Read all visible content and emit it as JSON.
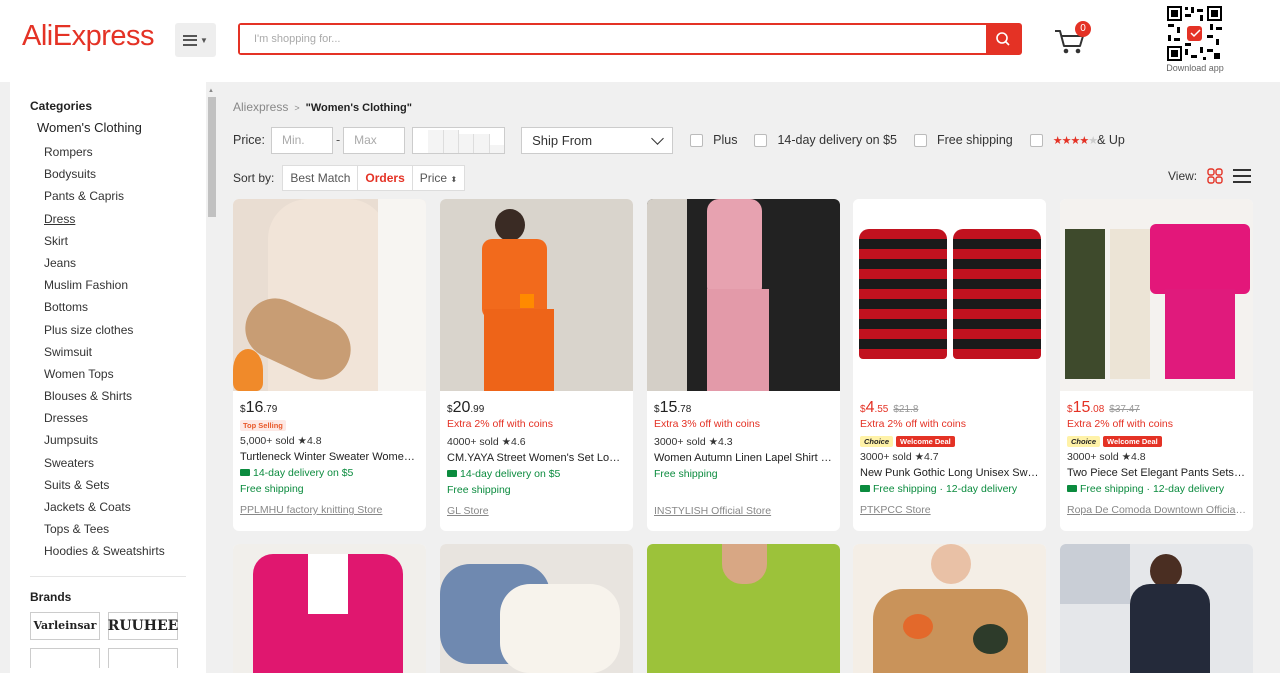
{
  "header": {
    "logo": "AliExpress",
    "search_placeholder": "I'm shopping for...",
    "cart_count": "0",
    "download_label": "Download app",
    "colors": {
      "accent": "#e43225"
    }
  },
  "sidebar": {
    "categories_title": "Categories",
    "main_category": "Women's Clothing",
    "items": [
      "Rompers",
      "Bodysuits",
      "Pants & Capris",
      "Dress",
      "Skirt",
      "Jeans",
      "Muslim Fashion",
      "Bottoms",
      "Plus size clothes",
      "Swimsuit",
      "Women Tops",
      "Blouses & Shirts",
      "Dresses",
      "Jumpsuits",
      "Sweaters",
      "Suits & Sets",
      "Jackets & Coats",
      "Tops & Tees",
      "Hoodies & Sweatshirts"
    ],
    "brands_title": "Brands",
    "brands": [
      "Varleinsar",
      "RUUHEE"
    ]
  },
  "breadcrumb": {
    "root": "Aliexpress",
    "sep": ">",
    "current": "\"Women's Clothing\""
  },
  "filters": {
    "price_label": "Price:",
    "min_placeholder": "Min.",
    "max_placeholder": "Max",
    "dash": "-",
    "ship_from": "Ship From",
    "plus": "Plus",
    "delivery": "14-day delivery on $5",
    "free_shipping": "Free shipping",
    "rating_up": "& Up"
  },
  "sort": {
    "label": "Sort by:",
    "options": [
      "Best Match",
      "Orders",
      "Price"
    ],
    "active": "Orders",
    "view_label": "View:"
  },
  "products": [
    {
      "currency": "$",
      "price_int": "16",
      "price_dec": ".79",
      "orig": "",
      "extra": "",
      "badge": "Top Selling",
      "sold": "5,000+ sold",
      "rating": "4.8",
      "title": "Turtleneck Winter Sweater Women Elegant Thick Warm",
      "ship1": "14-day delivery on $5",
      "ship2": "Free shipping",
      "store": "PPLMHU factory knitting Store"
    },
    {
      "currency": "$",
      "price_int": "20",
      "price_dec": ".99",
      "orig": "",
      "extra": "Extra 2% off with coins",
      "badge": "",
      "sold": "4000+ sold",
      "rating": "4.6",
      "title": "CM.YAYA Street Women's Set Long Sleeve Shirt",
      "ship1": "14-day delivery on $5",
      "ship2": "Free shipping",
      "store": "GL Store"
    },
    {
      "currency": "$",
      "price_int": "15",
      "price_dec": ".78",
      "orig": "",
      "extra": "Extra 3% off with coins",
      "badge": "",
      "sold": "3000+ sold",
      "rating": "4.3",
      "title": "Women Autumn Linen Lapel Shirt Suits",
      "ship1": "Free shipping",
      "ship2": "",
      "store": "INSTYLISH Official Store"
    },
    {
      "currency": "$",
      "price_int": "4",
      "price_dec": ".55",
      "orig": "$21.8",
      "extra": "Extra 2% off with coins",
      "badge": "choice",
      "sold": "3000+ sold",
      "rating": "4.7",
      "title": "New Punk Gothic Long Unisex Sweater",
      "ship1": "Free shipping · 12-day delivery",
      "ship2": "",
      "store": "PTKPCC Store"
    },
    {
      "currency": "$",
      "price_int": "15",
      "price_dec": ".08",
      "orig": "$37.47",
      "extra": "Extra 2% off with coins",
      "badge": "choice",
      "sold": "3000+ sold",
      "rating": "4.8",
      "title": "Two Piece Set Elegant Pants Sets Ice Silk",
      "ship1": "Free shipping · 12-day delivery",
      "ship2": "",
      "store": "Ropa De Comoda Downtown Official Store"
    }
  ],
  "badge_labels": {
    "choice": "Choice",
    "welcome": "Welcome Deal"
  }
}
